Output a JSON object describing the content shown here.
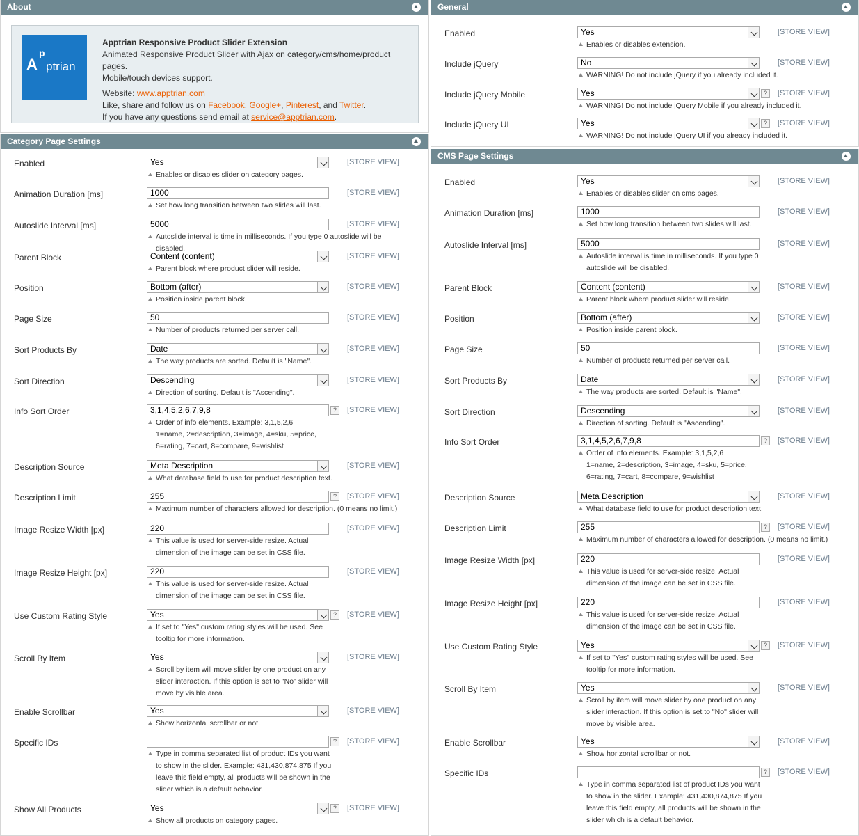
{
  "about": {
    "title": "About",
    "logo_text": "Apptrian",
    "heading": "Apptrian Responsive Product Slider Extension",
    "desc1": "Animated Responsive Product Slider with Ajax on category/cms/home/product pages.",
    "desc2": "Mobile/touch devices support.",
    "website_label": "Website: ",
    "website_link": "www.apptrian.com",
    "follow_prefix": "Like, share and follow us on ",
    "facebook": "Facebook",
    "googleplus": "Google+",
    "pinterest": "Pinterest",
    "and_text": ", and ",
    "twitter": "Twitter",
    "email_prefix": "If you have any questions send email at ",
    "email": "service@apptrian.com"
  },
  "scope_label": "[STORE VIEW]",
  "tip_glyph": "?",
  "category": {
    "title": "Category Page Settings",
    "rows": [
      {
        "label": "Enabled",
        "value": "Yes",
        "note": "Enables or disables slider on category pages."
      },
      {
        "label": "Animation Duration [ms]",
        "value": "1000",
        "note": "Set how long transition between two slides will last."
      },
      {
        "label": "Autoslide Interval [ms]",
        "value": "5000",
        "note": "Autoslide interval is time in milliseconds. If you type 0 autoslide will be disabled."
      },
      {
        "label": "Parent Block",
        "value": "Content (content)",
        "note": "Parent block where product slider will reside."
      },
      {
        "label": "Position",
        "value": "Bottom (after)",
        "note": "Position inside parent block."
      },
      {
        "label": "Page Size",
        "value": "50",
        "note": "Number of products returned per server call."
      },
      {
        "label": "Sort Products By",
        "value": "Date",
        "note": "The way products are sorted. Default is \"Name\"."
      },
      {
        "label": "Sort Direction",
        "value": "Descending",
        "note": "Direction of sorting. Default is \"Ascending\"."
      },
      {
        "label": "Info Sort Order",
        "value": "3,1,4,5,2,6,7,9,8",
        "note": "Order of info elements. Example: 3,1,5,2,6",
        "note2": "1=name, 2=description, 3=image, 4=sku, 5=price,",
        "note3": "6=rating, 7=cart, 8=compare, 9=wishlist"
      },
      {
        "label": "Description Source",
        "value": "Meta Description",
        "note": "What database field to use for product description text."
      },
      {
        "label": "Description Limit",
        "value": "255",
        "note": "Maximum number of characters allowed for description. (0 means no limit.)"
      },
      {
        "label": "Image Resize Width [px]",
        "value": "220",
        "note": "This value is used for server-side resize. Actual",
        "note2": "dimension of the image can be set in CSS file."
      },
      {
        "label": "Image Resize Height [px]",
        "value": "220",
        "note": "This value is used for server-side resize. Actual",
        "note2": "dimension of the image can be set in CSS file."
      },
      {
        "label": "Use Custom Rating Style",
        "value": "Yes",
        "note": "If set to \"Yes\" custom rating styles will be used. See",
        "note2": "tooltip for more information."
      },
      {
        "label": "Scroll By Item",
        "value": "Yes",
        "note": "Scroll by item will move slider by one product on any",
        "note2": "slider interaction. If this option is set to \"No\" slider will",
        "note3": "move by visible area."
      },
      {
        "label": "Enable Scrollbar",
        "value": "Yes",
        "note": "Show horizontal scrollbar or not."
      },
      {
        "label": "Specific IDs",
        "value": "",
        "note": "Type in comma separated list of product IDs you want",
        "note2": "to show in the slider. Example: 431,430,874,875 If you",
        "note3": "leave this field empty, all products will be shown in the",
        "note4": "slider which is a default behavior."
      },
      {
        "label": "Show All Products",
        "value": "Yes",
        "note": "Show all products on category pages."
      }
    ]
  },
  "general": {
    "title": "General",
    "rows": [
      {
        "label": "Enabled",
        "value": "Yes",
        "note": "Enables or disables extension."
      },
      {
        "label": "Include jQuery",
        "value": "No",
        "note": "WARNING! Do not include jQuery if you already included it."
      },
      {
        "label": "Include jQuery Mobile",
        "value": "Yes",
        "note": "WARNING! Do not include jQuery Mobile if you already included it."
      },
      {
        "label": "Include jQuery UI",
        "value": "Yes",
        "note": "WARNING! Do not include jQuery UI if you already included it."
      }
    ]
  },
  "cms": {
    "title": "CMS Page Settings",
    "rows": [
      {
        "label": "Enabled",
        "value": "Yes",
        "note": "Enables or disables slider on cms pages."
      },
      {
        "label": "Animation Duration [ms]",
        "value": "1000",
        "note": "Set how long transition between two slides will last."
      },
      {
        "label": "Autoslide Interval [ms]",
        "value": "5000",
        "note": "Autoslide interval is time in milliseconds. If you type 0",
        "note2": "autoslide will be disabled."
      },
      {
        "label": "Parent Block",
        "value": "Content (content)",
        "note": "Parent block where product slider will reside."
      },
      {
        "label": "Position",
        "value": "Bottom (after)",
        "note": "Position inside parent block."
      },
      {
        "label": "Page Size",
        "value": "50",
        "note": "Number of products returned per server call."
      },
      {
        "label": "Sort Products By",
        "value": "Date",
        "note": "The way products are sorted. Default is \"Name\"."
      },
      {
        "label": "Sort Direction",
        "value": "Descending",
        "note": "Direction of sorting. Default is \"Ascending\"."
      },
      {
        "label": "Info Sort Order",
        "value": "3,1,4,5,2,6,7,9,8",
        "note": "Order of info elements. Example: 3,1,5,2,6",
        "note2": "1=name, 2=description, 3=image, 4=sku, 5=price,",
        "note3": "6=rating, 7=cart, 8=compare, 9=wishlist"
      },
      {
        "label": "Description Source",
        "value": "Meta Description",
        "note": "What database field to use for product description text."
      },
      {
        "label": "Description Limit",
        "value": "255",
        "note": "Maximum number of characters allowed for description. (0 means no limit.)"
      },
      {
        "label": "Image Resize Width [px]",
        "value": "220",
        "note": "This value is used for server-side resize. Actual",
        "note2": "dimension of the image can be set in CSS file."
      },
      {
        "label": "Image Resize Height [px]",
        "value": "220",
        "note": "This value is used for server-side resize. Actual",
        "note2": "dimension of the image can be set in CSS file."
      },
      {
        "label": "Use Custom Rating Style",
        "value": "Yes",
        "note": "If set to \"Yes\" custom rating styles will be used. See",
        "note2": "tooltip for more information."
      },
      {
        "label": "Scroll By Item",
        "value": "Yes",
        "note": "Scroll by item will move slider by one product on any",
        "note2": "slider interaction. If this option is set to \"No\" slider will",
        "note3": "move by visible area."
      },
      {
        "label": "Enable Scrollbar",
        "value": "Yes",
        "note": "Show horizontal scrollbar or not."
      },
      {
        "label": "Specific IDs",
        "value": "",
        "note": "Type in comma separated list of product IDs you want",
        "note2": "to show in the slider. Example: 431,430,874,875 If you",
        "note3": "leave this field empty, all products will be shown in the",
        "note4": "slider which is a default behavior."
      }
    ]
  }
}
